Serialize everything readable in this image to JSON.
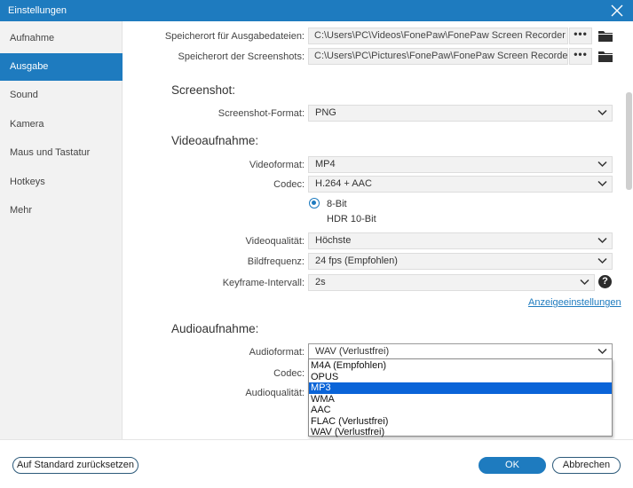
{
  "window": {
    "title": "Einstellungen"
  },
  "sidebar": {
    "items": [
      {
        "label": "Aufnahme"
      },
      {
        "label": "Ausgabe"
      },
      {
        "label": "Sound"
      },
      {
        "label": "Kamera"
      },
      {
        "label": "Maus und Tastatur"
      },
      {
        "label": "Hotkeys"
      },
      {
        "label": "Mehr"
      }
    ],
    "active_index": 1
  },
  "output": {
    "video_path_label": "Speicherort für Ausgabedateien:",
    "video_path": "C:\\Users\\PC\\Videos\\FonePaw\\FonePaw Screen Recorder",
    "screenshot_path_label": "Speicherort der Screenshots:",
    "screenshot_path": "C:\\Users\\PC\\Pictures\\FonePaw\\FonePaw Screen Recorder",
    "browse_label": "•••"
  },
  "screenshot": {
    "heading": "Screenshot:",
    "format_label": "Screenshot-Format:",
    "format_value": "PNG"
  },
  "video": {
    "heading": "Videoaufnahme:",
    "format_label": "Videoformat:",
    "format_value": "MP4",
    "codec_label": "Codec:",
    "codec_value": "H.264 + AAC",
    "bit_option_1": "8-Bit",
    "bit_option_2": "HDR 10-Bit",
    "quality_label": "Videoqualität:",
    "quality_value": "Höchste",
    "framerate_label": "Bildfrequenz:",
    "framerate_value": "24 fps (Empfohlen)",
    "keyframe_label": "Keyframe-Intervall:",
    "keyframe_value": "2s",
    "help_label": "?",
    "display_settings_link": "Anzeigeeinstellungen"
  },
  "audio": {
    "heading": "Audioaufnahme:",
    "format_label": "Audioformat:",
    "format_value": "WAV (Verlustfrei)",
    "codec_label": "Codec:",
    "quality_label": "Audioqualität:",
    "options": [
      "M4A (Empfohlen)",
      "OPUS",
      "MP3",
      "WMA",
      "AAC",
      "FLAC (Verlustfrei)",
      "WAV (Verlustfrei)"
    ],
    "highlighted_option": "MP3"
  },
  "footer": {
    "reset_label": "Auf Standard zurücksetzen",
    "ok_label": "OK",
    "cancel_label": "Abbrechen"
  },
  "colors": {
    "accent": "#1e7bbf",
    "dropdown_highlight": "#0a64d8"
  }
}
